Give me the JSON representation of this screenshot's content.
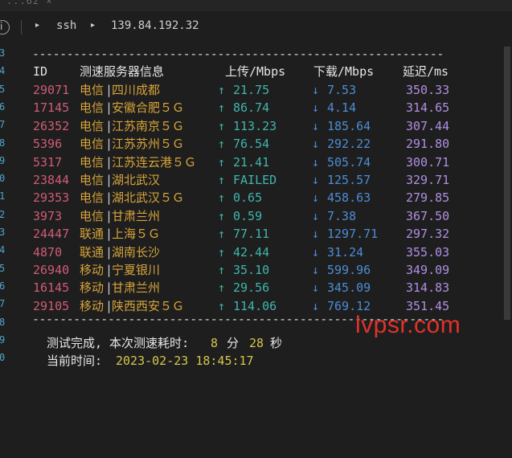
{
  "top_strip_text": "...62    ×",
  "breadcrumb": {
    "segments": [
      "ssh",
      "139.84.192.32"
    ]
  },
  "gutter_numbers": [
    "3",
    "4",
    "5",
    "6",
    "7",
    "8",
    "9",
    "0",
    "1",
    "2",
    "3",
    "4",
    "5",
    "6",
    "7",
    "8",
    "9",
    "0"
  ],
  "divider": "------------------------------------------------------------",
  "headers": {
    "id": "ID",
    "server": "测速服务器信息",
    "upload": "上传/Mbps",
    "download": "下载/Mbps",
    "latency": "延迟/ms"
  },
  "rows": [
    {
      "id": "29071",
      "isp": "电信",
      "sep": "|",
      "loc": "四川成都",
      "up_arrow": "↑",
      "up": "21.75",
      "down_arrow": "↓",
      "down": "7.53",
      "latency": "350.33"
    },
    {
      "id": "17145",
      "isp": "电信",
      "sep": "|",
      "loc": "安徽合肥５Ｇ",
      "up_arrow": "↑",
      "up": "86.74",
      "down_arrow": "↓",
      "down": "4.14",
      "latency": "314.65"
    },
    {
      "id": "26352",
      "isp": "电信",
      "sep": "|",
      "loc": "江苏南京５Ｇ",
      "up_arrow": "↑",
      "up": "113.23",
      "down_arrow": "↓",
      "down": "185.64",
      "latency": "307.44"
    },
    {
      "id": "5396",
      "isp": "电信",
      "sep": "|",
      "loc": "江苏苏州５Ｇ",
      "up_arrow": "↑",
      "up": "76.54",
      "down_arrow": "↓",
      "down": "292.22",
      "latency": "291.80"
    },
    {
      "id": "5317",
      "isp": "电信",
      "sep": "|",
      "loc": "江苏连云港５Ｇ",
      "up_arrow": "↑",
      "up": "21.41",
      "down_arrow": "↓",
      "down": "505.74",
      "latency": "300.71"
    },
    {
      "id": "23844",
      "isp": "电信",
      "sep": "|",
      "loc": "湖北武汉",
      "up_arrow": "↑",
      "up": "FAILED",
      "down_arrow": "↓",
      "down": "125.57",
      "latency": "329.71"
    },
    {
      "id": "29353",
      "isp": "电信",
      "sep": "|",
      "loc": "湖北武汉５Ｇ",
      "up_arrow": "↑",
      "up": "0.65",
      "down_arrow": "↓",
      "down": "458.63",
      "latency": "279.85"
    },
    {
      "id": "3973",
      "isp": "电信",
      "sep": "|",
      "loc": "甘肃兰州",
      "up_arrow": "↑",
      "up": "0.59",
      "down_arrow": "↓",
      "down": "7.38",
      "latency": "367.50"
    },
    {
      "id": "24447",
      "isp": "联通",
      "sep": "|",
      "loc": "上海５Ｇ",
      "up_arrow": "↑",
      "up": "77.11",
      "down_arrow": "↓",
      "down": "1297.71",
      "latency": "297.32"
    },
    {
      "id": "4870",
      "isp": "联通",
      "sep": "|",
      "loc": "湖南长沙",
      "up_arrow": "↑",
      "up": "42.44",
      "down_arrow": "↓",
      "down": "31.24",
      "latency": "355.03"
    },
    {
      "id": "26940",
      "isp": "移动",
      "sep": "|",
      "loc": "宁夏银川",
      "up_arrow": "↑",
      "up": "35.10",
      "down_arrow": "↓",
      "down": "599.96",
      "latency": "349.09"
    },
    {
      "id": "16145",
      "isp": "移动",
      "sep": "|",
      "loc": "甘肃兰州",
      "up_arrow": "↑",
      "up": "29.56",
      "down_arrow": "↓",
      "down": "345.09",
      "latency": "314.83"
    },
    {
      "id": "29105",
      "isp": "移动",
      "sep": "|",
      "loc": "陕西西安５Ｇ",
      "up_arrow": "↑",
      "up": "114.06",
      "down_arrow": "↓",
      "down": "769.12",
      "latency": "351.45"
    }
  ],
  "footer": {
    "done_label": "测试完成, 本次测速耗时:",
    "minutes": "8",
    "min_unit": "分",
    "seconds": "28",
    "sec_unit": "秒",
    "time_label": "当前时间:",
    "time_value": "2023-02-23 18:45:17"
  },
  "watermark": "lvpsr.com",
  "colors": {
    "background": "#1e1e1e",
    "id": "#d05b76",
    "isp_location": "#d7a43a",
    "upload": "#3fb6ad",
    "download": "#4c8dd6",
    "latency": "#b18fe3",
    "footer_value": "#d7c64a",
    "watermark": "#e0322b"
  }
}
